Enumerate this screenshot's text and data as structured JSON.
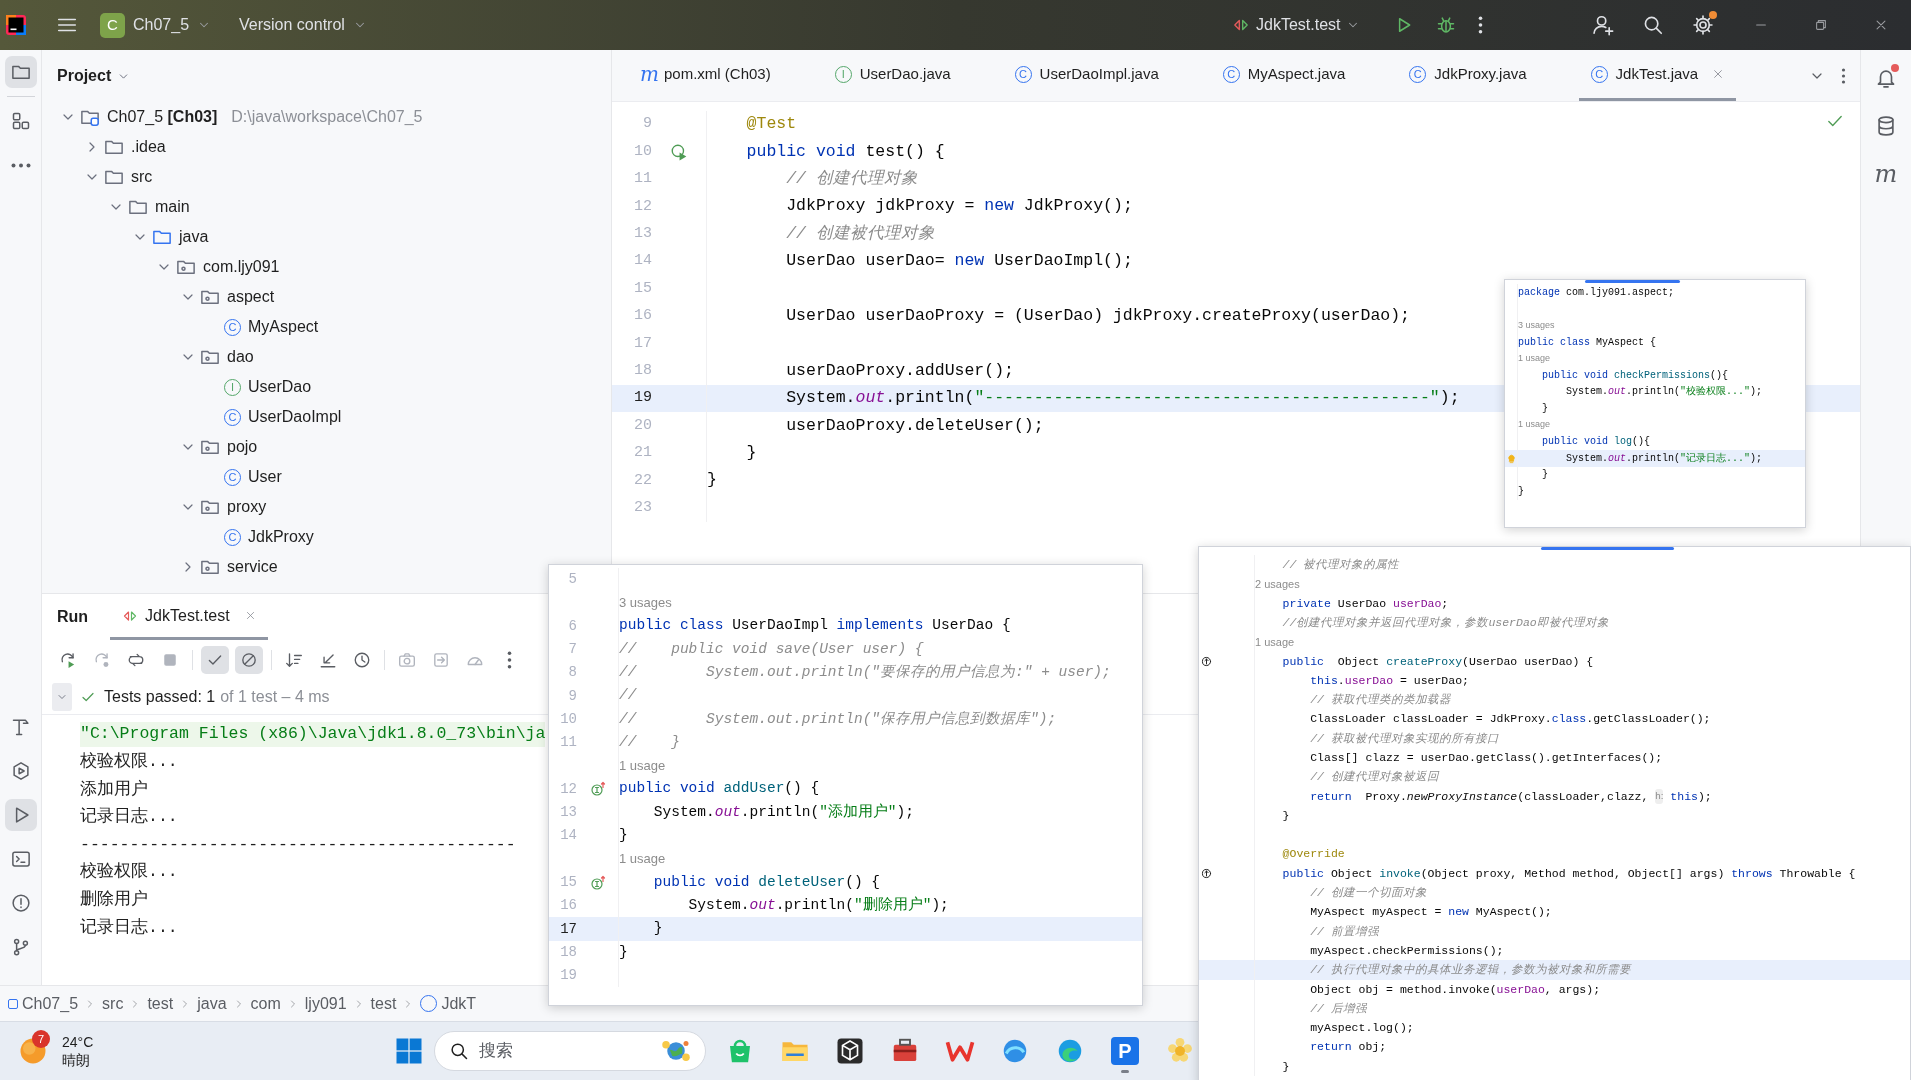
{
  "title_bar": {
    "project_badge": "C",
    "project": "Ch07_5",
    "vcs": "Version control",
    "run_config": "JdkTest.test",
    "actions": [
      {
        "kind": "add-user",
        "dot": false
      },
      {
        "kind": "search",
        "dot": false
      },
      {
        "kind": "settings",
        "dot": true
      }
    ]
  },
  "left_strip": {
    "top": [
      {
        "kind": "folder",
        "selected": true
      },
      {
        "kind": "structure",
        "selected": false
      },
      {
        "kind": "more",
        "selected": false
      }
    ],
    "bottom": [
      {
        "kind": "hammer",
        "selected": false
      },
      {
        "kind": "services",
        "selected": false
      },
      {
        "kind": "run",
        "selected": true
      },
      {
        "kind": "terminal",
        "selected": false
      },
      {
        "kind": "problems",
        "selected": false
      },
      {
        "kind": "git",
        "selected": false
      }
    ]
  },
  "project_panel": {
    "title": "Project",
    "tree": [
      {
        "label": "Ch07_5 **[Ch03]**",
        "path": "D:\\java\\workspace\\Ch07_5",
        "kind": "module",
        "expanded": true,
        "children": [
          {
            "label": ".idea",
            "kind": "folder",
            "expanded": false
          },
          {
            "label": "src",
            "kind": "folder",
            "expanded": true,
            "children": [
              {
                "label": "main",
                "kind": "folder",
                "expanded": true,
                "children": [
                  {
                    "label": "java",
                    "kind": "source",
                    "expanded": true,
                    "children": [
                      {
                        "label": "com.ljy091",
                        "kind": "package",
                        "expanded": true,
                        "children": [
                          {
                            "label": "aspect",
                            "kind": "package",
                            "expanded": true,
                            "children": [
                              {
                                "label": "MyAspect",
                                "kind": "class",
                                "glyph": "C"
                              }
                            ]
                          },
                          {
                            "label": "dao",
                            "kind": "package",
                            "expanded": true,
                            "children": [
                              {
                                "label": "UserDao",
                                "kind": "interface",
                                "glyph": "I"
                              },
                              {
                                "label": "UserDaoImpl",
                                "kind": "class",
                                "glyph": "C"
                              }
                            ]
                          },
                          {
                            "label": "pojo",
                            "kind": "package",
                            "expanded": true,
                            "children": [
                              {
                                "label": "User",
                                "kind": "class",
                                "glyph": "C"
                              }
                            ]
                          },
                          {
                            "label": "proxy",
                            "kind": "package",
                            "expanded": true,
                            "children": [
                              {
                                "label": "JdkProxy",
                                "kind": "class",
                                "glyph": "C"
                              }
                            ]
                          },
                          {
                            "label": "service",
                            "kind": "package",
                            "expanded": false
                          }
                        ]
                      }
                    ]
                  }
                ]
              }
            ]
          }
        ]
      }
    ]
  },
  "editor": {
    "tabs": [
      {
        "label": "pom.xml (Ch03)",
        "kind": "maven",
        "glyph": "m",
        "selected": false
      },
      {
        "label": "UserDao.java",
        "kind": "interface",
        "glyph": "I",
        "selected": false
      },
      {
        "label": "UserDaoImpl.java",
        "kind": "class",
        "glyph": "C",
        "selected": false
      },
      {
        "label": "MyAspect.java",
        "kind": "class",
        "glyph": "C",
        "selected": false
      },
      {
        "label": "JdkProxy.java",
        "kind": "class",
        "glyph": "C",
        "selected": false
      },
      {
        "label": "JdkTest.java",
        "kind": "class",
        "glyph": "C",
        "selected": true
      }
    ],
    "lines": [
      {
        "kind": "code",
        "n": "9",
        "current": false,
        "code": [
          {
            "kind": "ann",
            "text": "    @Test"
          }
        ]
      },
      {
        "kind": "code",
        "n": "10",
        "current": false,
        "gutter": {
          "kind": "run"
        },
        "code": [
          {
            "kind": "kw",
            "text": "    public void "
          },
          {
            "kind": "p",
            "text": "test() {"
          }
        ]
      },
      {
        "kind": "code",
        "n": "11",
        "current": false,
        "code": [
          {
            "kind": "cm",
            "text": "        // 创建代理对象"
          }
        ]
      },
      {
        "kind": "code",
        "n": "12",
        "current": false,
        "code": [
          {
            "kind": "p",
            "text": "        JdkProxy jdkProxy = "
          },
          {
            "kind": "kw",
            "text": "new "
          },
          {
            "kind": "p",
            "text": "JdkProxy();"
          }
        ]
      },
      {
        "kind": "code",
        "n": "13",
        "current": false,
        "code": [
          {
            "kind": "cm",
            "text": "        // 创建被代理对象"
          }
        ]
      },
      {
        "kind": "code",
        "n": "14",
        "current": false,
        "code": [
          {
            "kind": "p",
            "text": "        UserDao userDao= "
          },
          {
            "kind": "kw",
            "text": "new "
          },
          {
            "kind": "p",
            "text": "UserDaoImpl();"
          }
        ]
      },
      {
        "kind": "code",
        "n": "15"
      },
      {
        "kind": "code",
        "n": "16",
        "current": false,
        "code": [
          {
            "kind": "p",
            "text": "        UserDao userDaoProxy = (UserDao) jdkProxy.createProxy(userDao);"
          }
        ]
      },
      {
        "kind": "code",
        "n": "17"
      },
      {
        "kind": "code",
        "n": "18",
        "current": false,
        "code": [
          {
            "kind": "p",
            "text": "        userDaoProxy.addUser();"
          }
        ]
      },
      {
        "kind": "code",
        "n": "19",
        "current": true,
        "code": [
          {
            "kind": "p",
            "text": "        System."
          },
          {
            "kind": "fld",
            "text": "out"
          },
          {
            "kind": "p",
            "text": ".println("
          },
          {
            "kind": "str",
            "text": "\"---------------------------------------------\""
          },
          {
            "kind": "p",
            "text": ");"
          }
        ]
      },
      {
        "kind": "code",
        "n": "20",
        "current": false,
        "code": [
          {
            "kind": "p",
            "text": "        userDaoProxy.deleteUser();"
          }
        ]
      },
      {
        "kind": "code",
        "n": "21",
        "current": false,
        "code": [
          {
            "kind": "p",
            "text": "    }"
          }
        ]
      },
      {
        "kind": "code",
        "n": "22",
        "current": false,
        "code": [
          {
            "kind": "p",
            "text": "}"
          }
        ]
      },
      {
        "kind": "code",
        "n": "23"
      }
    ]
  },
  "right_strip": [
    {
      "kind": "bell",
      "unread": true
    },
    {
      "kind": "database",
      "unread": false
    },
    {
      "kind": "maven",
      "glyph": "m",
      "unread": false
    }
  ],
  "run_panel": {
    "title": "Run",
    "tab": {
      "label": "JdkTest.test",
      "selected": true
    },
    "toolbar": [
      {
        "kind": "rerun",
        "selected": false
      },
      {
        "kind": "rerun-failed",
        "selected": false
      },
      {
        "kind": "toggle",
        "selected": false
      },
      {
        "kind": "stop",
        "selected": false
      },
      {
        "kind": "separator"
      },
      {
        "kind": "check",
        "selected": true
      },
      {
        "kind": "ban",
        "selected": true
      },
      {
        "kind": "separator"
      },
      {
        "kind": "sort",
        "selected": false
      },
      {
        "kind": "collapse",
        "selected": false
      },
      {
        "kind": "clock",
        "selected": false
      },
      {
        "kind": "separator"
      },
      {
        "kind": "camera",
        "selected": false
      },
      {
        "kind": "export",
        "selected": false
      },
      {
        "kind": "gauge",
        "selected": false
      },
      {
        "kind": "more",
        "selected": false
      }
    ],
    "status": "Tests passed: 1",
    "status_detail": "of 1 test – 4 ms",
    "console": [
      {
        "kind": "command",
        "text": "\"C:\\Program Files (x86)\\Java\\jdk1.8.0_73\\bin\\ja"
      },
      {
        "kind": "output",
        "text": "校验权限..."
      },
      {
        "kind": "output",
        "text": "添加用户"
      },
      {
        "kind": "output",
        "text": "记录日志..."
      },
      {
        "kind": "output",
        "text": "--------------------------------------------"
      },
      {
        "kind": "output",
        "text": "校验权限..."
      },
      {
        "kind": "output",
        "text": "删除用户"
      },
      {
        "kind": "output",
        "text": "记录日志..."
      }
    ]
  },
  "breadcrumb": [
    "Ch07_5",
    "src",
    "test",
    "java",
    "com",
    "ljy091",
    "test",
    "JdkT"
  ],
  "taskbar": {
    "weather": {
      "badge": "7",
      "temp": "24°C",
      "condition": "晴朗"
    },
    "search": {
      "placeholder": "搜索"
    },
    "apps": [
      {
        "kind": "bag",
        "running": false
      },
      {
        "kind": "folder",
        "running": false
      },
      {
        "kind": "cube",
        "running": false
      },
      {
        "kind": "toolbox",
        "running": false
      },
      {
        "kind": "zigzag",
        "running": false
      },
      {
        "kind": "wave",
        "running": false
      },
      {
        "kind": "browser",
        "running": false
      },
      {
        "kind": "glyph",
        "glyph": "P",
        "running": true
      },
      {
        "kind": "flower",
        "running": false
      }
    ]
  },
  "previews": [
    {
      "kind": "aspect",
      "lines": [
        {
          "kind": "code",
          "current": false,
          "code": [
            {
              "kind": "kw",
              "text": "package "
            },
            {
              "kind": "p",
              "text": "com.ljy091.aspect;"
            }
          ]
        },
        {
          "kind": "code"
        },
        {
          "kind": "hint",
          "text": "3 usages"
        },
        {
          "kind": "code",
          "current": false,
          "code": [
            {
              "kind": "kw",
              "text": "public class "
            },
            {
              "kind": "p",
              "text": "MyAspect {"
            }
          ]
        },
        {
          "kind": "hint",
          "text": "1 usage"
        },
        {
          "kind": "code",
          "current": false,
          "code": [
            {
              "kind": "kw",
              "text": "    public void "
            },
            {
              "kind": "fn",
              "text": "checkPermissions"
            },
            {
              "kind": "p",
              "text": "(){"
            }
          ]
        },
        {
          "kind": "code",
          "current": false,
          "code": [
            {
              "kind": "p",
              "text": "        System."
            },
            {
              "kind": "fld",
              "text": "out"
            },
            {
              "kind": "p",
              "text": ".println("
            },
            {
              "kind": "str",
              "text": "\"校验权限...\""
            },
            {
              "kind": "p",
              "text": ");"
            }
          ]
        },
        {
          "kind": "code",
          "current": false,
          "code": [
            {
              "kind": "p",
              "text": "    }"
            }
          ]
        },
        {
          "kind": "hint",
          "text": "1 usage"
        },
        {
          "kind": "code",
          "current": false,
          "code": [
            {
              "kind": "kw",
              "text": "    public void "
            },
            {
              "kind": "fn",
              "text": "log"
            },
            {
              "kind": "p",
              "text": "(){"
            }
          ]
        },
        {
          "kind": "code",
          "current": true,
          "gutter": {
            "kind": "bulb"
          },
          "code": [
            {
              "kind": "p",
              "text": "        System."
            },
            {
              "kind": "fld",
              "text": "out"
            },
            {
              "kind": "p",
              "text": ".println("
            },
            {
              "kind": "str",
              "text": "\"记录日志...\""
            },
            {
              "kind": "p",
              "text": ");"
            }
          ]
        },
        {
          "kind": "code",
          "current": false,
          "code": [
            {
              "kind": "p",
              "text": "    }"
            }
          ]
        },
        {
          "kind": "code",
          "current": false,
          "code": [
            {
              "kind": "p",
              "text": "}"
            }
          ]
        }
      ]
    },
    {
      "kind": "impl",
      "lines": [
        {
          "kind": "code",
          "n": "5"
        },
        {
          "kind": "hint",
          "text": "3 usages"
        },
        {
          "kind": "code",
          "n": "6",
          "current": false,
          "code": [
            {
              "kind": "kw",
              "text": "public class "
            },
            {
              "kind": "p",
              "text": "UserDaoImpl "
            },
            {
              "kind": "kw",
              "text": "implements "
            },
            {
              "kind": "p",
              "text": "UserDao {"
            }
          ]
        },
        {
          "kind": "code",
          "n": "7",
          "current": false,
          "code": [
            {
              "kind": "cm",
              "text": "//    public void save(User user) {"
            }
          ]
        },
        {
          "kind": "code",
          "n": "8",
          "current": false,
          "code": [
            {
              "kind": "cm",
              "text": "//        System.out.println(\"要保存的用户信息为:\" + user);"
            }
          ]
        },
        {
          "kind": "code",
          "n": "9",
          "current": false,
          "code": [
            {
              "kind": "cm",
              "text": "//"
            }
          ]
        },
        {
          "kind": "code",
          "n": "10",
          "current": false,
          "code": [
            {
              "kind": "cm",
              "text": "//        System.out.println(\"保存用户信息到数据库\");"
            }
          ]
        },
        {
          "kind": "code",
          "n": "11",
          "current": false,
          "code": [
            {
              "kind": "cm",
              "text": "//    }"
            }
          ]
        },
        {
          "kind": "hint",
          "text": "1 usage"
        },
        {
          "kind": "code",
          "n": "12",
          "current": false,
          "gutter": {
            "kind": "impl"
          },
          "code": [
            {
              "kind": "kw",
              "text": "public void "
            },
            {
              "kind": "fn",
              "text": "addUser"
            },
            {
              "kind": "p",
              "text": "() {"
            }
          ]
        },
        {
          "kind": "code",
          "n": "13",
          "current": false,
          "code": [
            {
              "kind": "p",
              "text": "    System."
            },
            {
              "kind": "fld",
              "text": "out"
            },
            {
              "kind": "p",
              "text": ".println("
            },
            {
              "kind": "str",
              "text": "\"添加用户\""
            },
            {
              "kind": "p",
              "text": ");"
            }
          ]
        },
        {
          "kind": "code",
          "n": "14",
          "current": false,
          "code": [
            {
              "kind": "p",
              "text": "}"
            }
          ]
        },
        {
          "kind": "hint",
          "text": "1 usage"
        },
        {
          "kind": "code",
          "n": "15",
          "current": false,
          "gutter": {
            "kind": "impl"
          },
          "code": [
            {
              "kind": "kw",
              "text": "    public void "
            },
            {
              "kind": "fn",
              "text": "deleteUser"
            },
            {
              "kind": "p",
              "text": "() {"
            }
          ]
        },
        {
          "kind": "code",
          "n": "16",
          "current": false,
          "code": [
            {
              "kind": "p",
              "text": "        System."
            },
            {
              "kind": "fld",
              "text": "out"
            },
            {
              "kind": "p",
              "text": ".println("
            },
            {
              "kind": "str",
              "text": "\"删除用户\""
            },
            {
              "kind": "p",
              "text": ");"
            }
          ]
        },
        {
          "kind": "code",
          "n": "17",
          "current": true,
          "code": [
            {
              "kind": "p",
              "text": "    }"
            }
          ]
        },
        {
          "kind": "code",
          "n": "18",
          "current": false,
          "code": [
            {
              "kind": "p",
              "text": "}"
            }
          ]
        },
        {
          "kind": "code",
          "n": "19"
        }
      ]
    },
    {
      "kind": "proxy",
      "lines": [
        {
          "kind": "code",
          "current": false,
          "code": [
            {
              "kind": "cm",
              "text": "    // 被代理对象的属性"
            }
          ]
        },
        {
          "kind": "hint",
          "text": "2 usages"
        },
        {
          "kind": "code",
          "current": false,
          "code": [
            {
              "kind": "kw",
              "text": "    private "
            },
            {
              "kind": "p",
              "text": "UserDao "
            },
            {
              "kind": "fldp",
              "text": "userDao"
            },
            {
              "kind": "p",
              "text": ";"
            }
          ]
        },
        {
          "kind": "code",
          "current": false,
          "code": [
            {
              "kind": "cm",
              "text": "    //创建代理对象并返回代理对象，参数userDao即被代理对象"
            }
          ]
        },
        {
          "kind": "hint",
          "text": "1 usage"
        },
        {
          "kind": "code",
          "current": false,
          "gutter": {
            "kind": "override"
          },
          "code": [
            {
              "kind": "kw",
              "text": "    public"
            },
            {
              "kind": "p",
              "text": "  Object "
            },
            {
              "kind": "fn",
              "text": "createProxy"
            },
            {
              "kind": "p",
              "text": "(UserDao userDao) {"
            }
          ]
        },
        {
          "kind": "code",
          "current": false,
          "code": [
            {
              "kind": "kw",
              "text": "        this"
            },
            {
              "kind": "p",
              "text": "."
            },
            {
              "kind": "fldp",
              "text": "userDao"
            },
            {
              "kind": "p",
              "text": " = userDao;"
            }
          ]
        },
        {
          "kind": "code",
          "current": false,
          "code": [
            {
              "kind": "cm",
              "text": "        // 获取代理类的类加载器"
            }
          ]
        },
        {
          "kind": "code",
          "current": false,
          "code": [
            {
              "kind": "p",
              "text": "        ClassLoader classLoader = JdkProxy."
            },
            {
              "kind": "kw",
              "text": "class"
            },
            {
              "kind": "p",
              "text": ".getClassLoader();"
            }
          ]
        },
        {
          "kind": "code",
          "current": false,
          "code": [
            {
              "kind": "cm",
              "text": "        // 获取被代理对象实现的所有接口"
            }
          ]
        },
        {
          "kind": "code",
          "current": false,
          "code": [
            {
              "kind": "p",
              "text": "        Class[] clazz = userDao.getClass().getInterfaces();"
            }
          ]
        },
        {
          "kind": "code",
          "current": false,
          "code": [
            {
              "kind": "cm",
              "text": "        // 创建代理对象被返回"
            }
          ]
        },
        {
          "kind": "code",
          "current": false,
          "code": [
            {
              "kind": "kw",
              "text": "        return"
            },
            {
              "kind": "p",
              "text": "  Proxy."
            },
            {
              "kind": "it",
              "text": "newProxyInstance"
            },
            {
              "kind": "p",
              "text": "(classLoader,clazz, "
            },
            {
              "kind": "inlay",
              "text": "h:"
            },
            {
              "kind": "kw",
              "text": " this"
            },
            {
              "kind": "p",
              "text": ");"
            }
          ]
        },
        {
          "kind": "code",
          "current": false,
          "code": [
            {
              "kind": "p",
              "text": "    }"
            }
          ]
        },
        {
          "kind": "code"
        },
        {
          "kind": "code",
          "current": false,
          "code": [
            {
              "kind": "ann",
              "text": "    @Override"
            }
          ]
        },
        {
          "kind": "code",
          "current": false,
          "gutter": {
            "kind": "override"
          },
          "code": [
            {
              "kind": "kw",
              "text": "    public "
            },
            {
              "kind": "p",
              "text": "Object "
            },
            {
              "kind": "fn",
              "text": "invoke"
            },
            {
              "kind": "p",
              "text": "(Object proxy, Method method, Object[] args) "
            },
            {
              "kind": "kw",
              "text": "throws "
            },
            {
              "kind": "p",
              "text": "Throwable {"
            }
          ]
        },
        {
          "kind": "code",
          "current": false,
          "code": [
            {
              "kind": "cm",
              "text": "        // 创建一个切面对象"
            }
          ]
        },
        {
          "kind": "code",
          "current": false,
          "code": [
            {
              "kind": "p",
              "text": "        MyAspect myAspect = "
            },
            {
              "kind": "kw",
              "text": "new "
            },
            {
              "kind": "p",
              "text": "MyAspect();"
            }
          ]
        },
        {
          "kind": "code",
          "current": false,
          "code": [
            {
              "kind": "cm",
              "text": "        // 前置增强"
            }
          ]
        },
        {
          "kind": "code",
          "current": false,
          "code": [
            {
              "kind": "p",
              "text": "        myAspect.checkPermissions();"
            }
          ]
        },
        {
          "kind": "code",
          "current": true,
          "code": [
            {
              "kind": "cm",
              "text": "        // 执行代理对象中的具体业务逻辑，参数为被对象和所需要"
            }
          ]
        },
        {
          "kind": "code",
          "current": false,
          "code": [
            {
              "kind": "p",
              "text": "        Object obj = method.invoke("
            },
            {
              "kind": "fldp",
              "text": "userDao"
            },
            {
              "kind": "p",
              "text": ", args);"
            }
          ]
        },
        {
          "kind": "code",
          "current": false,
          "code": [
            {
              "kind": "cm",
              "text": "        // 后增强"
            }
          ]
        },
        {
          "kind": "code",
          "current": false,
          "code": [
            {
              "kind": "p",
              "text": "        myAspect.log();"
            }
          ]
        },
        {
          "kind": "code",
          "current": false,
          "code": [
            {
              "kind": "kw",
              "text": "        return "
            },
            {
              "kind": "p",
              "text": "obj;"
            }
          ]
        },
        {
          "kind": "code",
          "current": false,
          "code": [
            {
              "kind": "p",
              "text": "    }"
            }
          ]
        }
      ]
    }
  ]
}
